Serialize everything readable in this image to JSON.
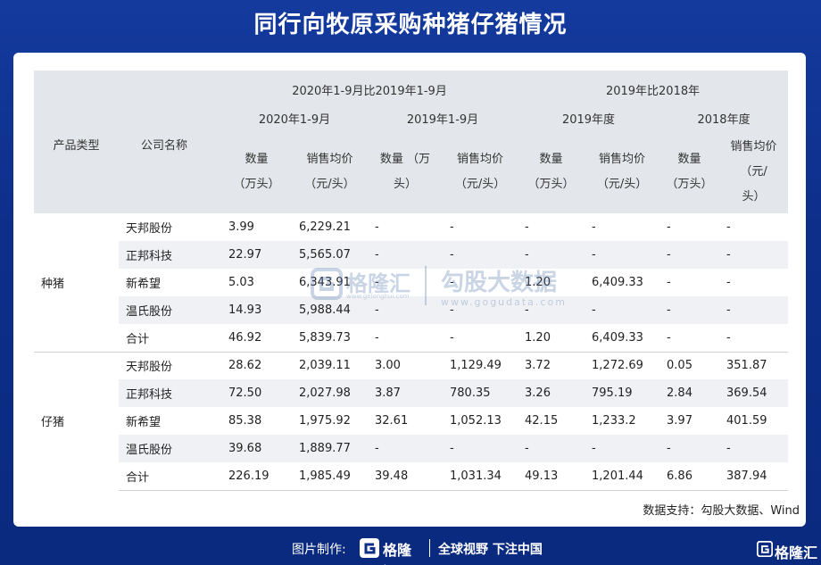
{
  "title": "同行向牧原采购种猪仔猪情况",
  "table": {
    "col_product_type": "产品类型",
    "col_company": "公司名称",
    "group_2020_vs_2019": "2020年1-9月比2019年1-9月",
    "group_2019_vs_2018": "2019年比2018年",
    "period_2020_1_9": "2020年1-9月",
    "period_2019_1_9": "2019年1-9月",
    "period_2019": "2019年度",
    "period_2018": "2018年度",
    "qty_label": "数量（万头）",
    "price_label": "销售均价（元/头）",
    "h_qty_a": "数量",
    "h_qty_a_unit": "（万头）",
    "h_price_a": "销售均价",
    "h_price_a_unit": "（元/头）",
    "h_qty_b": "数量 （万",
    "h_qty_b_unit": "头）",
    "h_price_b": "销售均价",
    "h_price_b_unit": "（元/头）",
    "h_qty_c": "数量",
    "h_qty_c_unit": "（万头）",
    "h_price_c": "销售均价",
    "h_price_c_unit": "（元/头）",
    "h_qty_d": "数量",
    "h_qty_d_unit": "（万头）",
    "h_price_d": "销售均价",
    "h_price_d_unit1": "（元/",
    "h_price_d_unit2": "头）"
  },
  "groups": [
    {
      "label": "种猪",
      "rows": [
        {
          "company": "天邦股份",
          "v": [
            "3.99",
            "6,229.21",
            "-",
            "-",
            "-",
            "-",
            "-",
            "-"
          ]
        },
        {
          "company": "正邦科技",
          "v": [
            "22.97",
            "5,565.07",
            "-",
            "-",
            "-",
            "-",
            "-",
            "-"
          ]
        },
        {
          "company": "新希望",
          "v": [
            "5.03",
            "6,343.91",
            "-",
            "-",
            "1.20",
            "6,409.33",
            "-",
            "-"
          ]
        },
        {
          "company": "温氏股份",
          "v": [
            "14.93",
            "5,988.44",
            "-",
            "-",
            "-",
            "-",
            "-",
            "-"
          ]
        },
        {
          "company": "合计",
          "v": [
            "46.92",
            "5,839.73",
            "-",
            "-",
            "1.20",
            "6,409.33",
            "-",
            "-"
          ]
        }
      ]
    },
    {
      "label": "仔猪",
      "rows": [
        {
          "company": "天邦股份",
          "v": [
            "28.62",
            "2,039.11",
            "3.00",
            "1,129.49",
            "3.72",
            "1,272.69",
            "0.05",
            "351.87"
          ]
        },
        {
          "company": "正邦科技",
          "v": [
            "72.50",
            "2,027.98",
            "3.87",
            "780.35",
            "3.26",
            "795.19",
            "2.84",
            "369.54"
          ]
        },
        {
          "company": "新希望",
          "v": [
            "85.38",
            "1,975.92",
            "32.61",
            "1,052.13",
            "42.15",
            "1,233.2",
            "3.97",
            "401.59"
          ]
        },
        {
          "company": "温氏股份",
          "v": [
            "39.68",
            "1,889.77",
            "-",
            "-",
            "-",
            "-",
            "-",
            "-"
          ]
        },
        {
          "company": "合计",
          "v": [
            "226.19",
            "1,985.49",
            "39.48",
            "1,031.34",
            "49.13",
            "1,201.44",
            "6.86",
            "387.94"
          ]
        }
      ]
    }
  ],
  "source": "数据支持：勾股大数据、Wind",
  "watermark": {
    "name1": "格隆汇",
    "domain1": "www.gelonghui.com",
    "name2": "勾股大数据",
    "domain2": "www.gogudata.com"
  },
  "footer": {
    "made_by": "图片制作:",
    "logo_text": "格隆汇",
    "slogan": "全球视野 下注中国",
    "corner_text": "格隆汇"
  }
}
